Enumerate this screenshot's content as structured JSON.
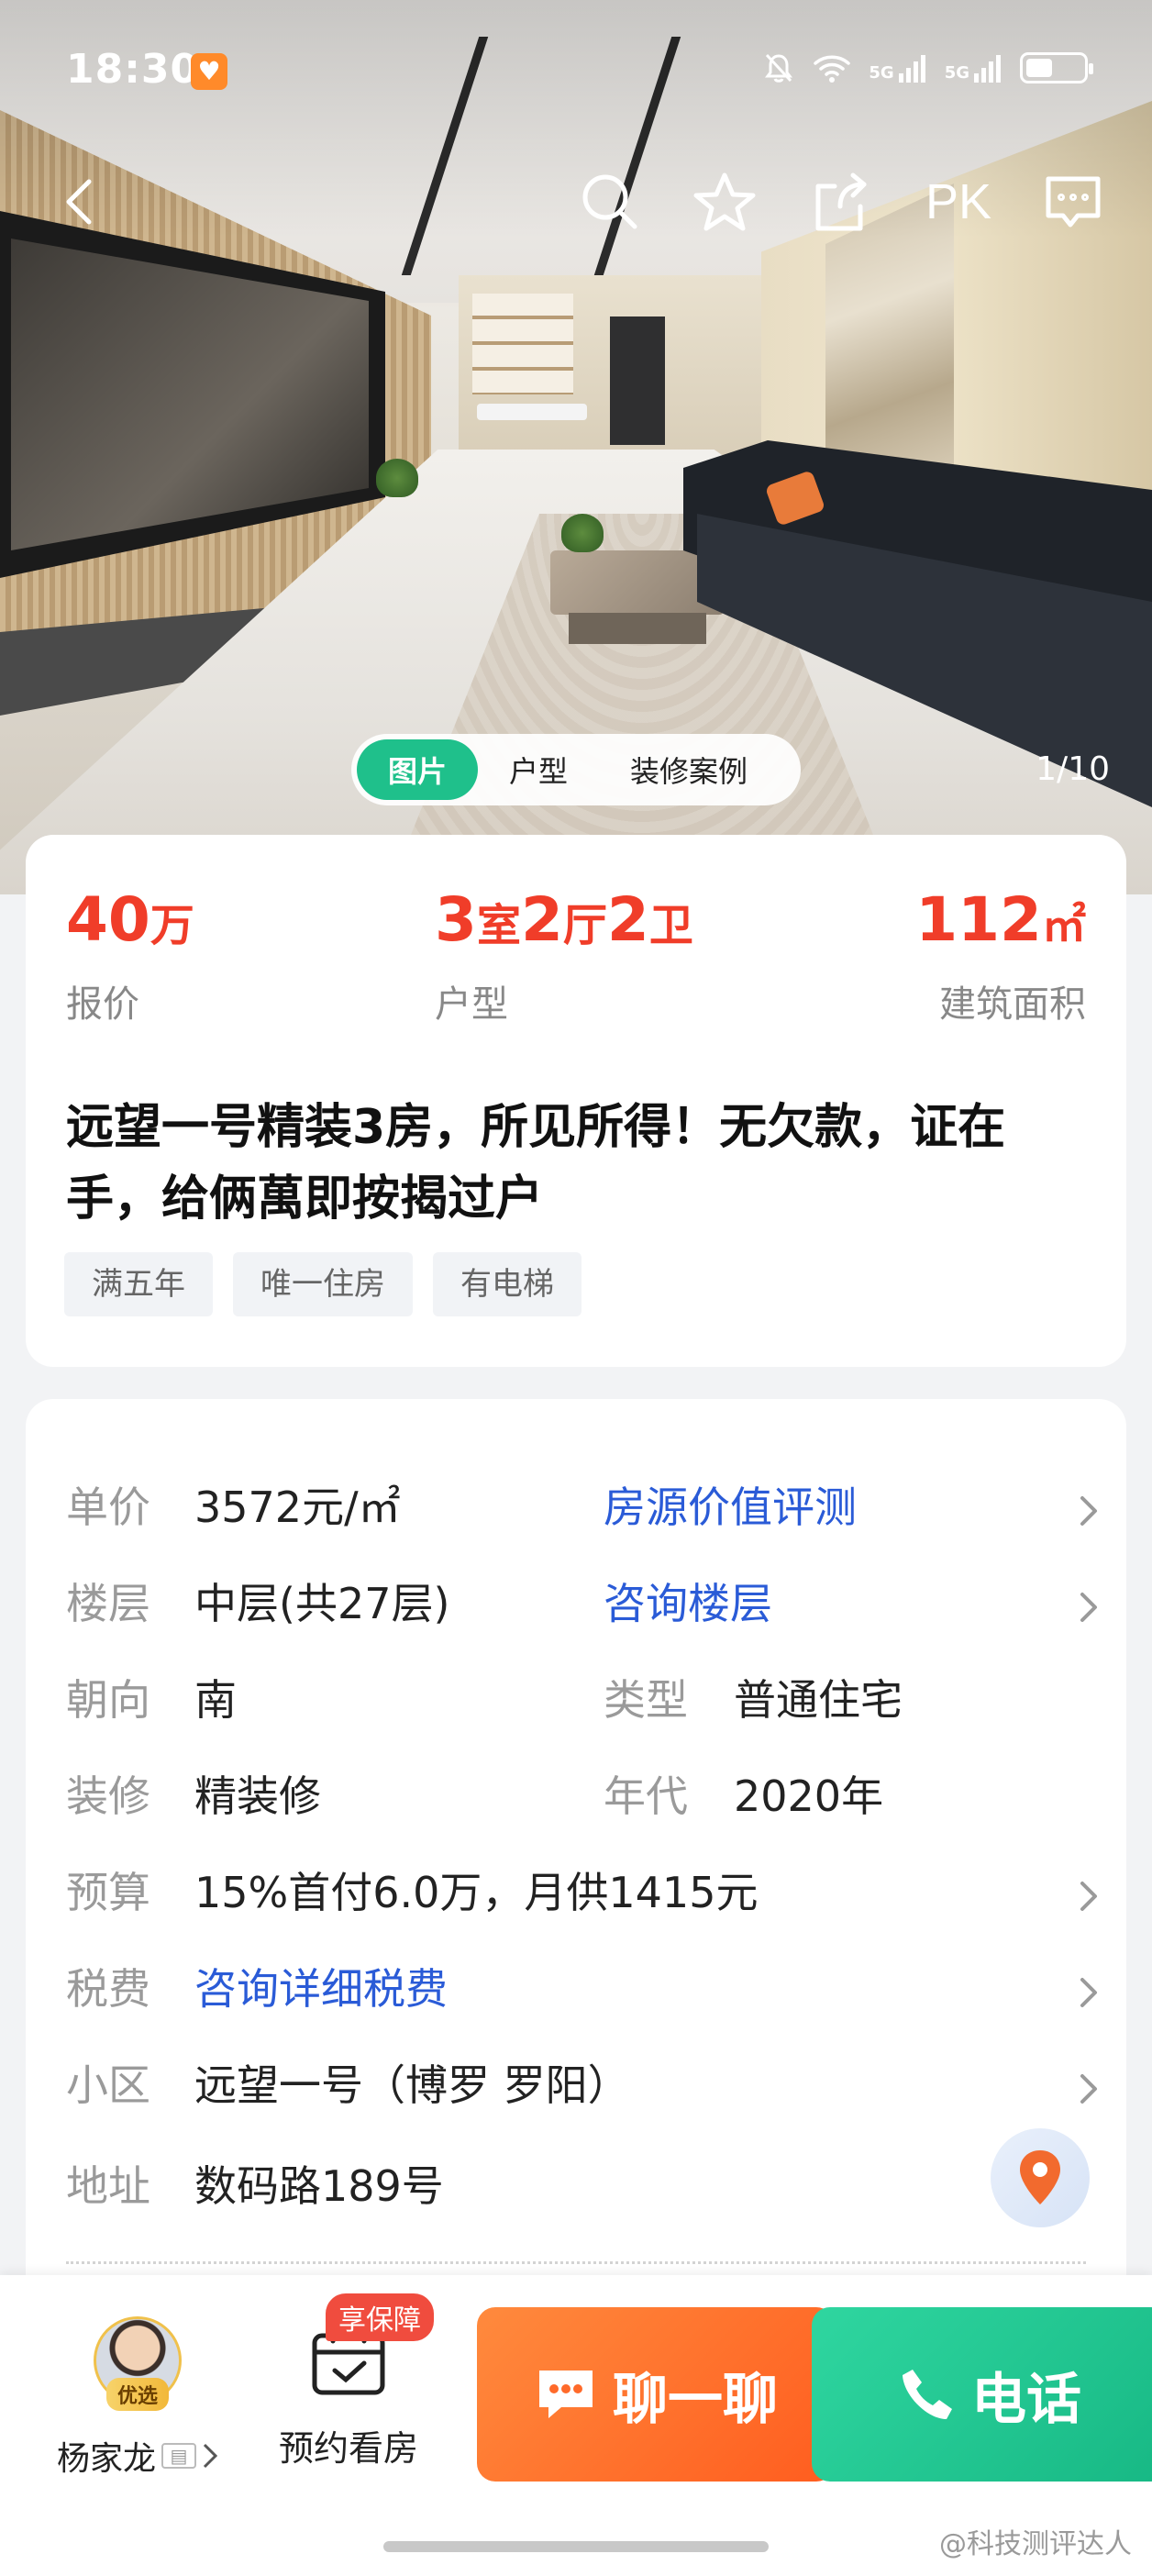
{
  "status_bar": {
    "time": "18:30",
    "signal_1": "5G",
    "signal_2": "5G",
    "battery_level": 0.45
  },
  "nav": {
    "pk_label": "PK"
  },
  "gallery": {
    "tabs": [
      "图片",
      "户型",
      "装修案例"
    ],
    "active_tab": 0,
    "counter": "1/10"
  },
  "summary": {
    "price": {
      "number": "40",
      "unit": "万",
      "label": "报价"
    },
    "layout": {
      "n1": "3",
      "u1": "室",
      "n2": "2",
      "u2": "厅",
      "n3": "2",
      "u3": "卫",
      "label": "户型"
    },
    "area": {
      "number": "112",
      "unit": "㎡",
      "label": "建筑面积"
    },
    "title": "远望一号精装3房，所见所得！无欠款，证在手，给俩萬即按揭过户",
    "tags": [
      "满五年",
      "唯一住房",
      "有电梯"
    ]
  },
  "details": {
    "unit_price": {
      "label": "单价",
      "value": "3572元/㎡",
      "link": "房源价值评测"
    },
    "floor": {
      "label": "楼层",
      "value": "中层(共27层)",
      "link": "咨询楼层"
    },
    "orientation": {
      "label": "朝向",
      "value": "南",
      "label2": "类型",
      "value2": "普通住宅"
    },
    "decoration": {
      "label": "装修",
      "value": "精装修",
      "label2": "年代",
      "value2": "2020年"
    },
    "budget": {
      "label": "预算",
      "value": "15%首付6.0万，月供1415元"
    },
    "tax": {
      "label": "税费",
      "link": "咨询详细税费"
    },
    "community": {
      "label": "小区",
      "value": "远望一号（博罗 罗阳）"
    },
    "address": {
      "label": "地址",
      "value": "数码路189号"
    }
  },
  "bottom_bar": {
    "agent_name": "杨家龙",
    "agent_badge": "优选",
    "guarantee_badge": "享保障",
    "appointment_label": "预约看房",
    "chat_label": "聊一聊",
    "call_label": "电话"
  },
  "watermark": "@科技测评达人",
  "colors": {
    "accent_red": "#f03d29",
    "link_blue": "#2a5bd7",
    "green": "#1fc08b",
    "orange": "#ff6a2a"
  }
}
